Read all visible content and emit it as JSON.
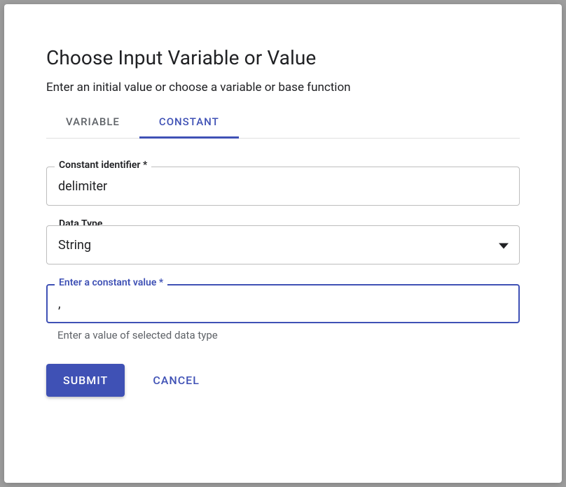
{
  "title": "Choose Input Variable or Value",
  "subtitle": "Enter an initial value or choose a variable or base function",
  "tabs": {
    "variable": "VARIABLE",
    "constant": "CONSTANT"
  },
  "fields": {
    "identifier": {
      "label": "Constant identifier *",
      "value": "delimiter"
    },
    "dataType": {
      "label": "Data Type",
      "value": "String"
    },
    "constantValue": {
      "label": "Enter a constant value *",
      "value": ",",
      "helper": "Enter a value of selected data type"
    }
  },
  "actions": {
    "submit": "SUBMIT",
    "cancel": "CANCEL"
  }
}
